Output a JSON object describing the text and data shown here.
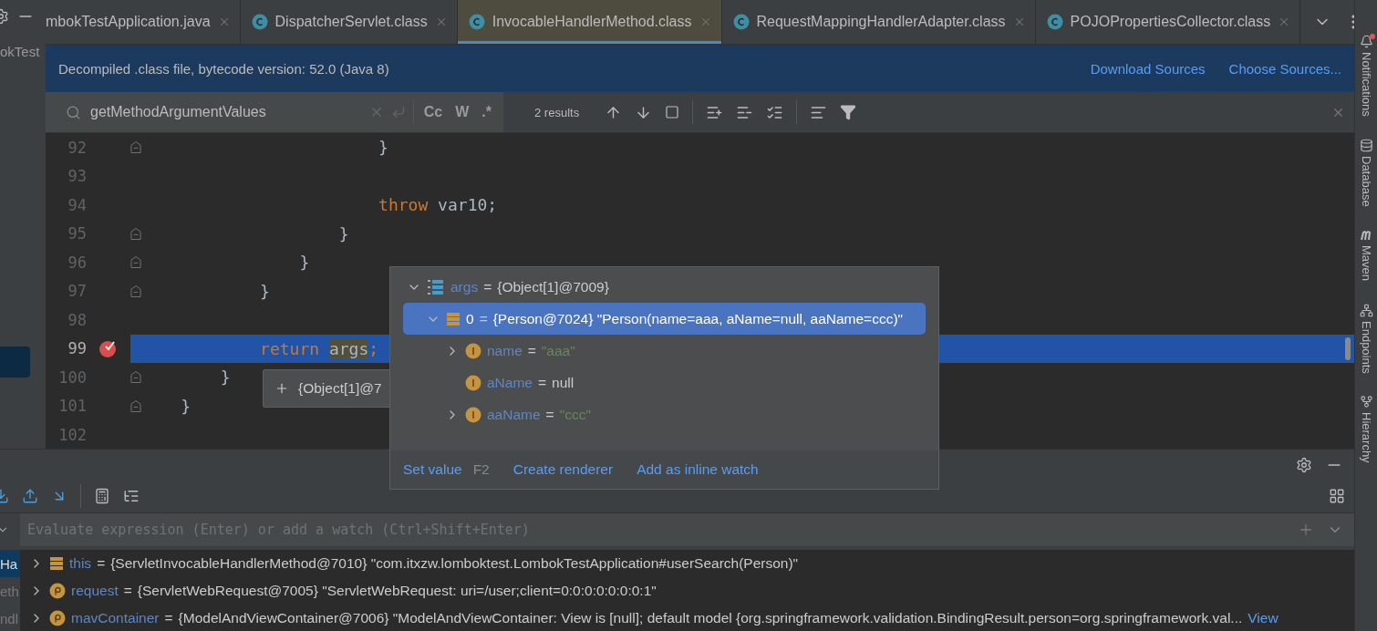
{
  "project_pane": {
    "label": "okTest"
  },
  "editor_tabs": [
    {
      "label": "mbokTestApplication.java",
      "icon": false,
      "selected": false
    },
    {
      "label": "DispatcherServlet.class",
      "icon": true,
      "selected": false
    },
    {
      "label": "InvocableHandlerMethod.class",
      "icon": true,
      "selected": true
    },
    {
      "label": "RequestMappingHandlerAdapter.class",
      "icon": true,
      "selected": false
    },
    {
      "label": "POJOPropertiesCollector.class",
      "icon": true,
      "selected": false
    }
  ],
  "notice": {
    "text": "Decompiled .class file, bytecode version: 52.0 (Java 8)",
    "links": [
      "Download Sources",
      "Choose Sources..."
    ]
  },
  "find": {
    "query": "getMethodArgumentValues",
    "options": [
      {
        "label": "Cc",
        "on": false
      },
      {
        "label": "W",
        "on": false
      },
      {
        "label": ".*",
        "on": false
      }
    ],
    "results": "2 results"
  },
  "editor": {
    "lines": [
      {
        "number": "92",
        "tokens": [
          {
            "text": "                        }",
            "kind": "plain"
          }
        ],
        "fold": true,
        "breakpoint": false,
        "current": false
      },
      {
        "number": "93",
        "fold": false,
        "breakpoint": false,
        "current": false
      },
      {
        "number": "94",
        "tokens": [
          {
            "text": "                        throw",
            "kind": "keyword"
          },
          {
            "text": " var10;",
            "kind": "plain"
          }
        ],
        "fold": false,
        "breakpoint": false,
        "current": false
      },
      {
        "number": "95",
        "tokens": [
          {
            "text": "                    }",
            "kind": "plain"
          }
        ],
        "fold": true,
        "breakpoint": false,
        "current": false
      },
      {
        "number": "96",
        "tokens": [
          {
            "text": "                }",
            "kind": "plain"
          }
        ],
        "fold": true,
        "breakpoint": false,
        "current": false
      },
      {
        "number": "97",
        "tokens": [
          {
            "text": "            }",
            "kind": "plain"
          }
        ],
        "fold": true,
        "breakpoint": false,
        "current": false
      },
      {
        "number": "98",
        "fold": false,
        "breakpoint": false,
        "current": false
      },
      {
        "number": "99",
        "tokens": [
          {
            "text": "            return ",
            "kind": "keyword"
          },
          {
            "text": "args",
            "kind": "usage"
          },
          {
            "text": ";",
            "kind": "keyword"
          }
        ],
        "fold": false,
        "breakpoint": true,
        "current": true
      },
      {
        "number": "100",
        "tokens": [
          {
            "text": "        }",
            "kind": "plain"
          }
        ],
        "fold": true,
        "breakpoint": false,
        "current": false
      },
      {
        "number": "101",
        "tokens": [
          {
            "text": "    }",
            "kind": "plain"
          }
        ],
        "fold": true,
        "breakpoint": false,
        "current": false
      },
      {
        "number": "102",
        "fold": false,
        "breakpoint": false,
        "current": false
      }
    ]
  },
  "tooltip": {
    "text": "{Object[1]@7"
  },
  "popup": {
    "tree": [
      {
        "name": "args",
        "sep": "=",
        "value": "{Object[1]@7009}",
        "kind": "array",
        "expanded": true,
        "leaf": false,
        "selected": false,
        "children": [
          {
            "name": "0",
            "sep": "=",
            "value": "{Person@7024} \"Person(name=aaa, aName=null, aaName=ccc)\"",
            "kind": "object",
            "expanded": true,
            "leaf": false,
            "selected": true,
            "children": [
              {
                "name": "name",
                "sep": "=",
                "value": "\"aaa\"",
                "kind": "literal",
                "expanded": false,
                "leaf": false,
                "selected": false
              },
              {
                "name": "aName",
                "sep": "=",
                "value": "null",
                "kind": "field",
                "expanded": false,
                "leaf": true,
                "selected": false
              },
              {
                "name": "aaName",
                "sep": "=",
                "value": "\"ccc\"",
                "kind": "literal",
                "expanded": false,
                "leaf": false,
                "selected": false
              }
            ]
          }
        ]
      }
    ],
    "actions": [
      {
        "label": "Set value",
        "shortcut": "F2"
      },
      {
        "label": "Create renderer"
      },
      {
        "label": "Add as inline watch"
      }
    ]
  },
  "debugger": {
    "frames": [
      {
        "label": "Ha",
        "selected": true
      },
      {
        "label": "eth",
        "selected": false
      },
      {
        "label": "ndl",
        "selected": false
      }
    ],
    "watch_placeholder": "Evaluate expression (Enter) or add a watch (Ctrl+Shift+Enter)",
    "variables": [
      {
        "name": "this",
        "sep": "=",
        "value": "{ServletInvocableHandlerMethod@7010} \"com.itxzw.lomboktest.LombokTestApplication#userSearch(Person)\"",
        "kind": "object",
        "expanded": false
      },
      {
        "name": "request",
        "sep": "=",
        "value": "{ServletWebRequest@7005} \"ServletWebRequest: uri=/user;client=0:0:0:0:0:0:0:1\"",
        "kind": "param",
        "expanded": false
      },
      {
        "name": "mavContainer",
        "sep": "=",
        "value": "{ModelAndViewContainer@7006} \"ModelAndViewContainer: View is [null]; default model {org.springframework.validation.BindingResult.person=org.springframework.val...",
        "link": "View",
        "kind": "param",
        "expanded": false
      }
    ]
  },
  "tool_windows": [
    {
      "label": "Notifications",
      "kind": "bell",
      "alert": true
    },
    {
      "label": "Database",
      "kind": "database",
      "alert": false
    },
    {
      "label": "Maven",
      "kind": "m",
      "alert": false
    },
    {
      "label": "Endpoints",
      "kind": "network",
      "alert": false
    },
    {
      "label": "Hierarchy",
      "kind": "hierarchy",
      "alert": false
    }
  ]
}
